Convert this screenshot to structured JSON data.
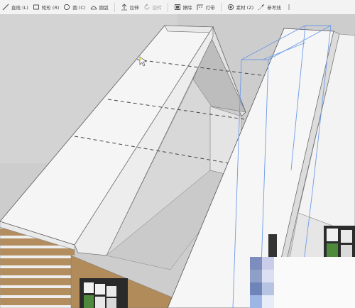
{
  "toolbar": {
    "tools": [
      {
        "name": "line-tool",
        "label": "直线 (L)",
        "icon": "line-icon",
        "disabled": false
      },
      {
        "name": "rectangle-tool",
        "label": "矩形 (R)",
        "icon": "rectangle-icon",
        "disabled": false
      },
      {
        "name": "circle-tool",
        "label": "圆 (C)",
        "icon": "circle-icon",
        "disabled": false
      },
      {
        "name": "arc-tool",
        "label": "圆弧",
        "icon": "arc-icon",
        "disabled": false
      },
      {
        "name": "pushpull-tool",
        "label": "拉伸",
        "icon": "pushpull-icon",
        "disabled": false
      },
      {
        "name": "rotate-tool",
        "label": "旋转",
        "icon": "rotate-icon",
        "disabled": true
      },
      {
        "name": "erase-tool",
        "label": "擦除",
        "icon": "eraser-icon",
        "disabled": false
      },
      {
        "name": "light-tool",
        "label": "灯带",
        "icon": "lightstrip-icon",
        "disabled": false
      },
      {
        "name": "material-tool",
        "label": "素材 (Z)",
        "icon": "material-icon",
        "disabled": false
      },
      {
        "name": "reference-line-tool",
        "label": "参考线",
        "icon": "reference-line-icon",
        "disabled": false
      }
    ],
    "overflow": {
      "label": "",
      "icon": "overflow-icon"
    }
  },
  "colors": {
    "toolbar_bg": "#f3f3f3",
    "canvas_bg": "#cfcfcf",
    "wall_white": "#f6f6f6",
    "wall_shade": "#dcdcdc",
    "wood": "#b08a5a",
    "selection_blue": "#6d9ae8",
    "window_green": "#4f8a3c"
  },
  "palette": {
    "swatches": [
      "#7d8dbd",
      "#c9cdea",
      "#8fa0c8",
      "#dcdff2",
      "#6f84b8",
      "#b7c3e3",
      "#9db6e6",
      "#e7ecf8"
    ]
  },
  "cursor": {
    "icon": "arrow-cursor-icon"
  }
}
